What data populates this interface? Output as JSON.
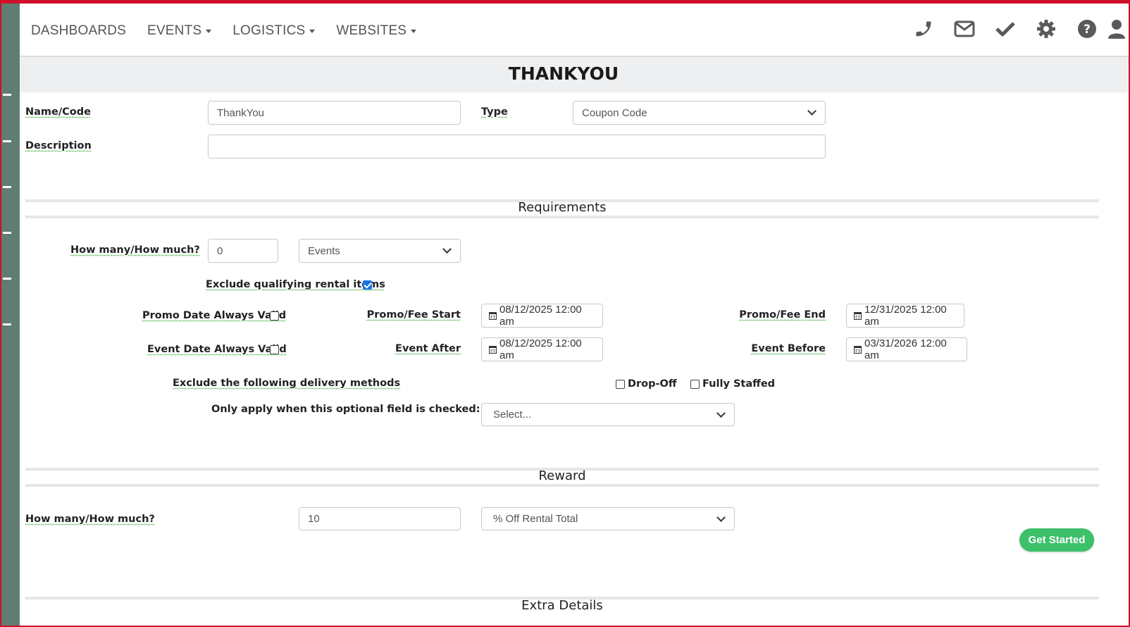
{
  "nav": {
    "items": [
      {
        "label": "DASHBOARDS",
        "dropdown": false
      },
      {
        "label": "EVENTS",
        "dropdown": true
      },
      {
        "label": "LOGISTICS",
        "dropdown": true
      },
      {
        "label": "WEBSITES",
        "dropdown": true
      }
    ],
    "icons": [
      "phone-icon",
      "envelope-icon",
      "checkmark-icon",
      "gear-icon",
      "question-icon",
      "user-icon"
    ]
  },
  "page": {
    "title": "THANKYOU"
  },
  "form": {
    "name_label": "Name/Code",
    "name_value": "ThankYou",
    "type_label": "Type",
    "type_value": "Coupon Code",
    "description_label": "Description",
    "description_value": ""
  },
  "requirements": {
    "title": "Requirements",
    "how_many_label": "How many/How much?",
    "how_many_value": "0",
    "unit_value": "Events",
    "exclude_items_label": "Exclude qualifying rental items",
    "exclude_items_checked": true,
    "promo_always_label": "Promo Date Always Valid",
    "promo_always_checked": false,
    "promo_start_label": "Promo/Fee Start",
    "promo_start_value": "08/12/2025 12:00 am",
    "promo_end_label": "Promo/Fee End",
    "promo_end_value": "12/31/2025 12:00 am",
    "event_always_label": "Event Date Always Valid",
    "event_always_checked": false,
    "event_after_label": "Event After",
    "event_after_value": "08/12/2025 12:00 am",
    "event_before_label": "Event Before",
    "event_before_value": "03/31/2026 12:00 am",
    "exclude_delivery_label": "Exclude the following delivery methods",
    "dropoff_label": "Drop-Off",
    "dropoff_checked": false,
    "staffed_label": "Fully Staffed",
    "staffed_checked": false,
    "optional_field_label": "Only apply when this optional field is checked:",
    "optional_field_value": "Select..."
  },
  "reward": {
    "title": "Reward",
    "how_many_label": "How many/How much?",
    "how_many_value": "10",
    "reward_type_value": "% Off Rental Total"
  },
  "extra": {
    "title": "Extra Details"
  },
  "cta": {
    "get_started": "Get Started"
  },
  "colors": {
    "rail": "#5f7d72",
    "cta": "#3cc06a",
    "frame": "#d0102a",
    "checkbox": "#1a73e8"
  }
}
